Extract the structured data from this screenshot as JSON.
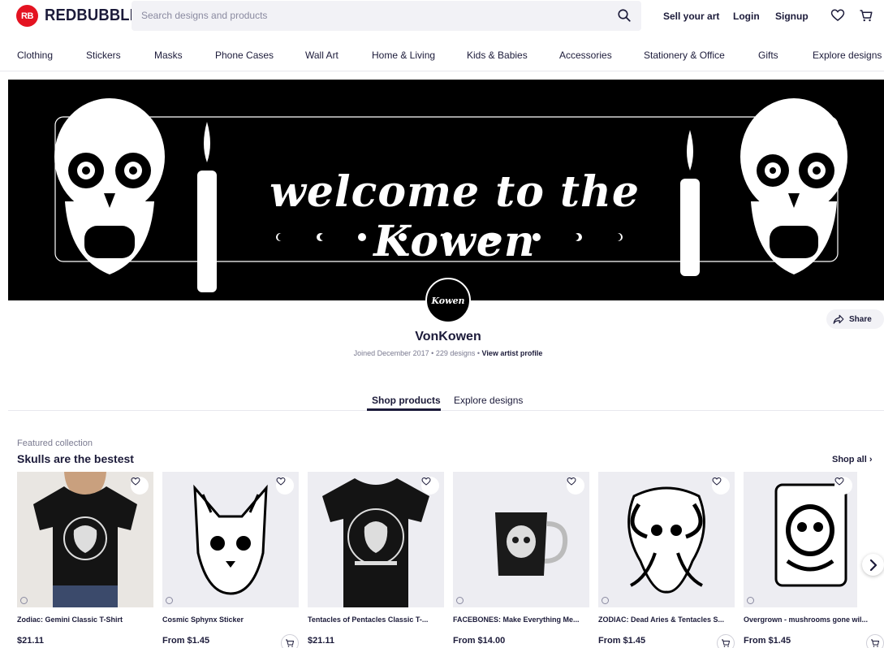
{
  "header": {
    "logo_badge": "RB",
    "logo_text": "REDBUBBLE",
    "search_placeholder": "Search designs and products",
    "sell_label": "Sell your art",
    "login_label": "Login",
    "signup_label": "Signup"
  },
  "categories": [
    "Clothing",
    "Stickers",
    "Masks",
    "Phone Cases",
    "Wall Art",
    "Home & Living",
    "Kids & Babies",
    "Accessories",
    "Stationery & Office",
    "Gifts",
    "Explore designs"
  ],
  "banner": {
    "title": "welcome to the Kowen"
  },
  "profile": {
    "avatar_text": "Kowen",
    "name": "VonKowen",
    "joined": "Joined December 2017",
    "designs": "229 designs",
    "view_profile": "View artist profile",
    "share_label": "Share"
  },
  "tabs": {
    "shop": "Shop products",
    "explore": "Explore designs"
  },
  "collection": {
    "eyebrow": "Featured collection",
    "title": "Skulls are the bestest",
    "shop_all": "Shop all ›",
    "products": [
      {
        "title": "Zodiac: Gemini Classic T-Shirt",
        "price": "$21.11",
        "type": "shirt-model"
      },
      {
        "title": "Cosmic Sphynx Sticker",
        "price": "From $1.45",
        "type": "sticker"
      },
      {
        "title": "Tentacles of Pentacles Classic T-...",
        "price": "$21.11",
        "type": "shirt"
      },
      {
        "title": "FACEBONES: Make Everything Me...",
        "price": "From $14.00",
        "type": "mug"
      },
      {
        "title": "ZODIAC: Dead Aries & Tentacles S...",
        "price": "From $1.45",
        "type": "sticker"
      },
      {
        "title": "Overgrown - mushrooms gone wil...",
        "price": "From $1.45",
        "type": "sticker"
      }
    ]
  },
  "colors": {
    "brand_red": "#e41321",
    "text_dark": "#1c1b3a",
    "muted": "#7a7a90"
  }
}
